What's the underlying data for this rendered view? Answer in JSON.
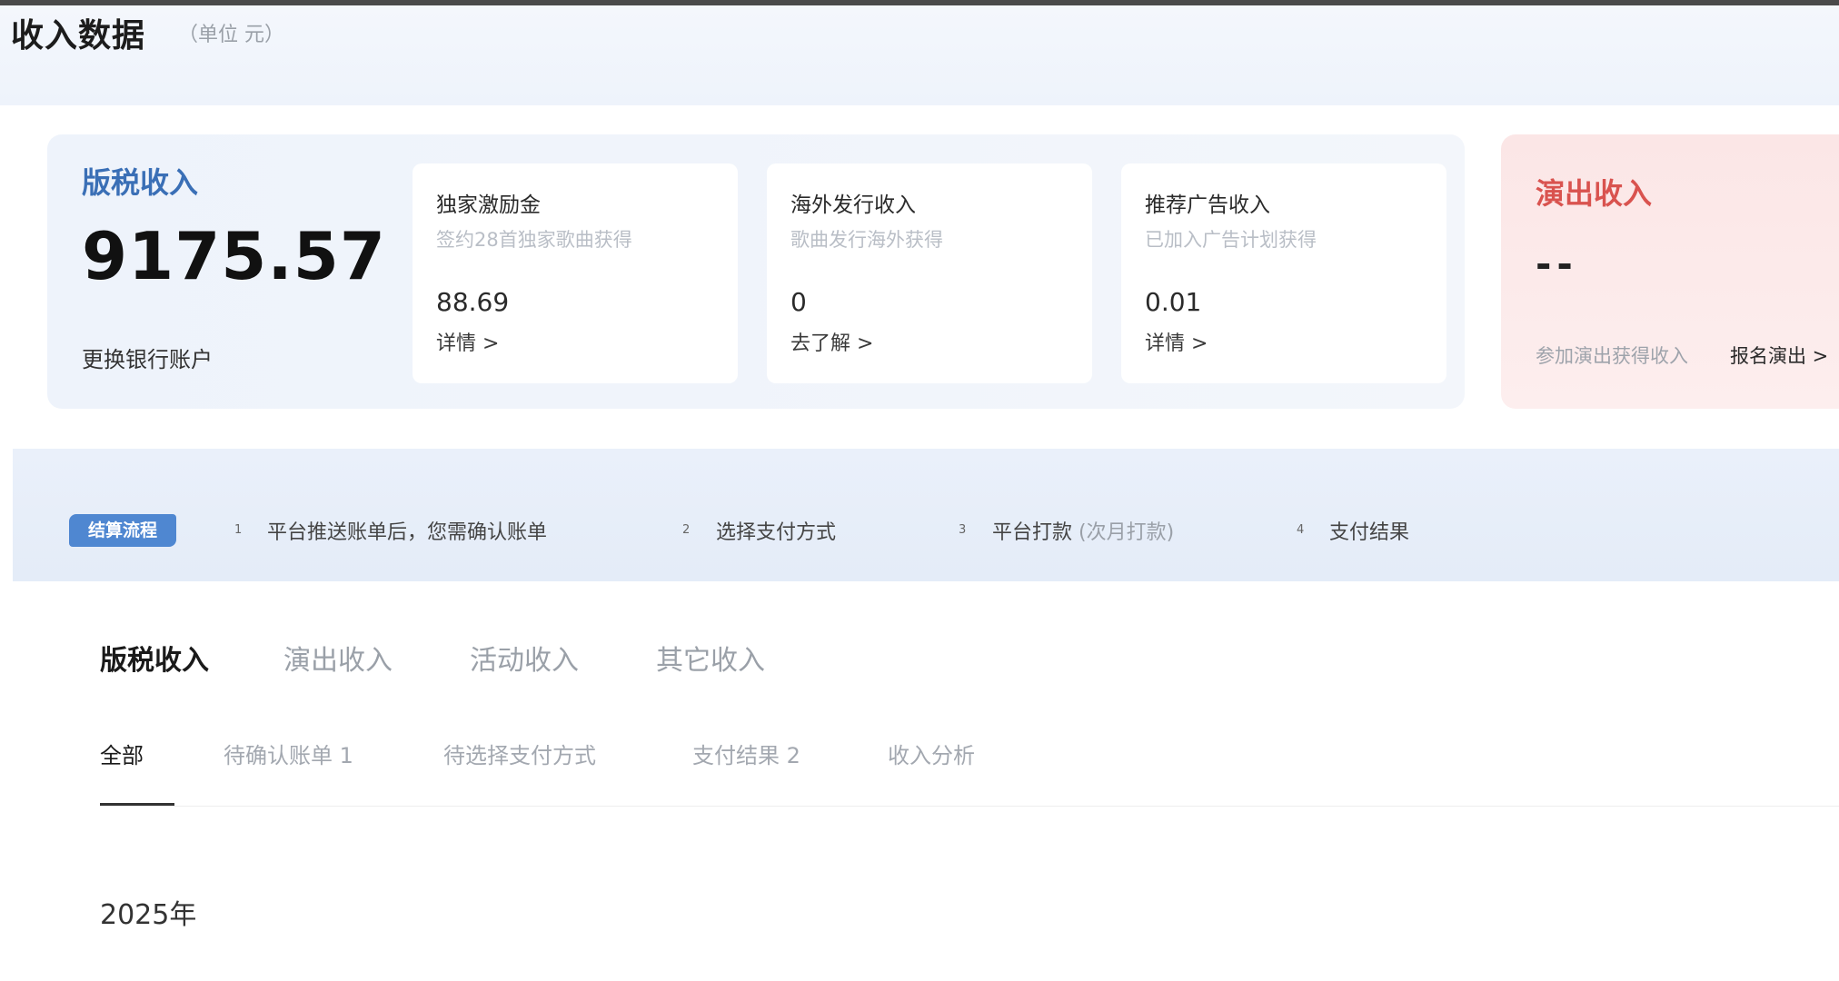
{
  "header": {
    "title": "收入数据",
    "unit": "（单位 元）"
  },
  "royalty": {
    "title": "版税收入",
    "amount": "9175.57",
    "bank_link": "更换银行账户",
    "cards": [
      {
        "title": "独家激励金",
        "desc": "签约28首独家歌曲获得",
        "value": "88.69",
        "link": "详情 >"
      },
      {
        "title": "海外发行收入",
        "desc": "歌曲发行海外获得",
        "value": "0",
        "link": "去了解 >"
      },
      {
        "title": "推荐广告收入",
        "desc": "已加入广告计划获得",
        "value": "0.01",
        "link": "详情 >"
      }
    ]
  },
  "show": {
    "title": "演出收入",
    "value": "--",
    "desc": "参加演出获得收入",
    "link": "报名演出 >"
  },
  "flow": {
    "badge": "结算流程",
    "steps": [
      {
        "num": "1",
        "text": "平台推送账单后，您需确认账单",
        "sub": ""
      },
      {
        "num": "2",
        "text": "选择支付方式",
        "sub": ""
      },
      {
        "num": "3",
        "text": "平台打款",
        "sub": "(次月打款)"
      },
      {
        "num": "4",
        "text": "支付结果",
        "sub": ""
      }
    ]
  },
  "category_tabs": [
    "版税收入",
    "演出收入",
    "活动收入",
    "其它收入"
  ],
  "sub_tabs": [
    "全部",
    "待确认账单 1",
    "待选择支付方式",
    "支付结果 2",
    "收入分析"
  ],
  "year_label": "2025年",
  "colors": {
    "accent_blue": "#3a6fb6",
    "badge_blue": "#4f87d1",
    "show_red": "#d9534f"
  }
}
